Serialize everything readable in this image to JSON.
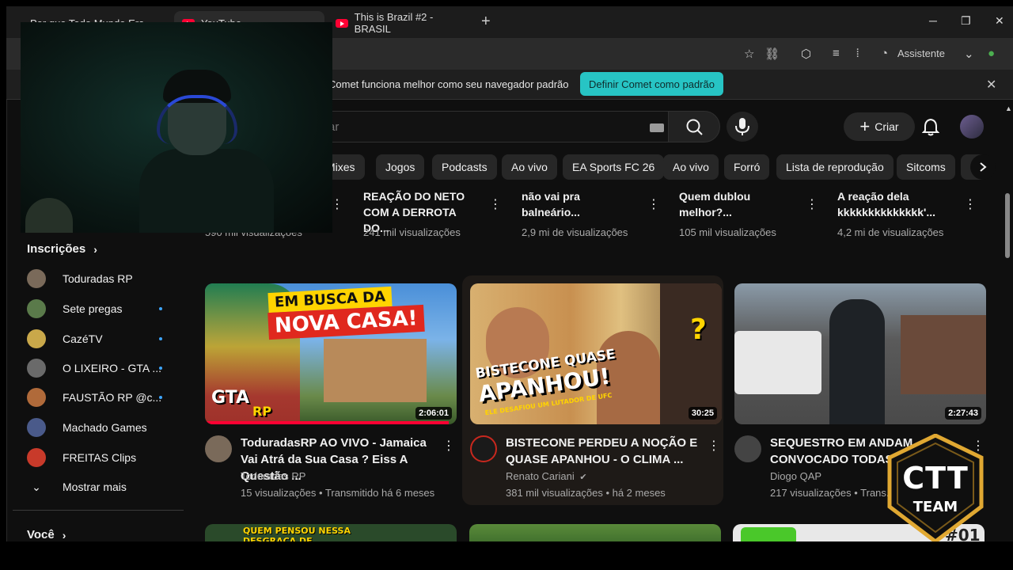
{
  "browser": {
    "tabs": [
      {
        "label": "Por que Todo Mundo Era..."
      },
      {
        "label": "YouTube"
      },
      {
        "label": "This is Brazil #2 - BRASIL"
      }
    ],
    "new_tab": "+",
    "assistant_label": "Assistente",
    "infobar_message": "Comet funciona melhor como seu navegador padrão",
    "infobar_button": "Definir Comet como padrão"
  },
  "youtube": {
    "search_placeholder": "ar",
    "create_label": "Criar",
    "chips": [
      "Mixes",
      "Jogos",
      "Podcasts",
      "Ao vivo",
      "EA Sports FC 26",
      "Ao vivo",
      "Forró",
      "Lista de reprodução",
      "Sitcoms",
      "R"
    ],
    "sidebar": {
      "subscriptions_heading": "Inscrições",
      "subscriptions": [
        {
          "name": "Toduradas RP",
          "new": false,
          "color": "#7a6a5a"
        },
        {
          "name": "Sete pregas",
          "new": true,
          "color": "#5a7a4a"
        },
        {
          "name": "CazéTV",
          "new": true,
          "color": "#c9a84a"
        },
        {
          "name": "O LIXEIRO - GTA ...",
          "new": true,
          "color": "#6a6a6a"
        },
        {
          "name": "FAUSTÃO RP @c...",
          "new": true,
          "color": "#b06a3a"
        },
        {
          "name": "Machado Games",
          "new": false,
          "color": "#4a5a8a"
        },
        {
          "name": "FREITAS Clips",
          "new": false,
          "color": "#c83a2a"
        }
      ],
      "show_more": "Mostrar mais",
      "you_heading": "Você"
    },
    "top_row": [
      {
        "title": "",
        "meta": "590 mil visualizações"
      },
      {
        "title": "REAÇÃO DO NETO COM A DERROTA DO...",
        "meta": "241 mil visualizações"
      },
      {
        "title": "não vai pra balneário...",
        "meta": "2,9 mi de visualizações"
      },
      {
        "title": "Quem dublou melhor?...",
        "meta": "105 mil visualizações"
      },
      {
        "title": "A reação dela kkkkkkkkkkkkkk'...",
        "meta": "4,2 mi de visualizações"
      }
    ],
    "videos": [
      {
        "title": "TodurasRP AO VIVO - Jamaica Vai Atrá da Sua Casa ? Eiss A Questão ...",
        "title_display": "ToduradasRP AO VIVO - Jamaica Vai Atrá da Sua Casa ? Eiss A Questão ...",
        "channel": "Toduradas RP",
        "stats": "15 visualizações • Transmitido há 6 meses",
        "duration": "2:06:01",
        "thumb_text1": "EM BUSCA DA",
        "thumb_text2": "NOVA CASA!",
        "thumb_text3": "GTA",
        "thumb_text4": "RP",
        "watched": 0.97
      },
      {
        "title_display": "BISTECONE PERDEU A NOÇÃO E QUASE APANHOU - O CLIMA ...",
        "channel": "Renato Cariani",
        "verified": "✔",
        "stats": "381 mil visualizações • há 2 meses",
        "duration": "30:25",
        "thumb_text1": "BISTECONE QUASE",
        "thumb_text2": "APANHOU!",
        "thumb_text3": "ELE DESAFIOU UM LUTADOR DE UFC",
        "thumb_text4": "?"
      },
      {
        "title_display": "SEQUESTRO EM ANDAM... CONVOCADO TODAS A...",
        "channel": "Diogo QAP",
        "stats": "217 visualizações • Trans...",
        "duration": "2:27:43"
      }
    ],
    "bottom_row_thumb_text": "QUEM PENSOU NESSA DESGRAÇA DE FILME???",
    "bottom_row_badge": "#01"
  },
  "watermark": {
    "line1": "CTT",
    "line2": "TEAM"
  }
}
